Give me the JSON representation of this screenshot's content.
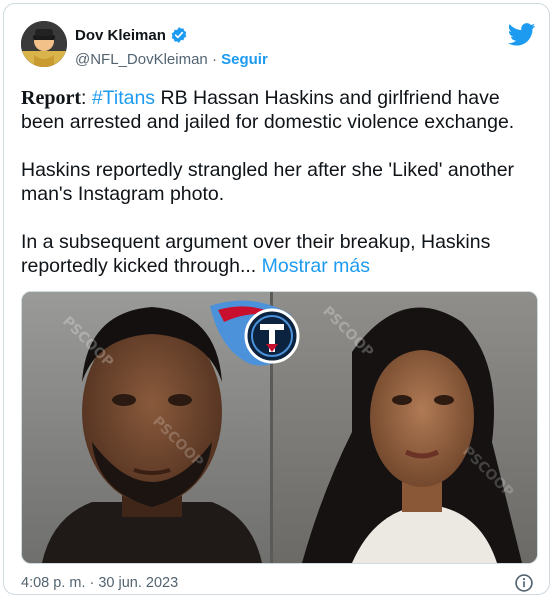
{
  "author": {
    "name": "Dov Kleiman",
    "handle": "@NFL_DovKleiman",
    "separator": "·",
    "follow_label": "Seguir"
  },
  "tweet": {
    "report_label": "Report",
    "colon": ":",
    "hashtag": "#Titans",
    "line1_rest": "RB Hassan Haskins and girlfriend have been arrested and jailed for domestic violence exchange.",
    "para2": "Haskins reportedly strangled her after she 'Liked' another man's Instagram photo.",
    "para3": "In a subsequent argument over their breakup, Haskins reportedly kicked through...",
    "show_more": "Mostrar más"
  },
  "media": {
    "watermark": "PSCOOP"
  },
  "footer": {
    "timestamp": "4:08 p. m. · 30 jun. 2023"
  },
  "colors": {
    "accent": "#1d9bf0",
    "verified": "#1d9bf0",
    "secondary_text": "#536471",
    "border": "#cfd9de"
  },
  "icons": [
    "verified-badge-icon",
    "twitter-bird-icon",
    "info-icon",
    "titans-logo"
  ]
}
